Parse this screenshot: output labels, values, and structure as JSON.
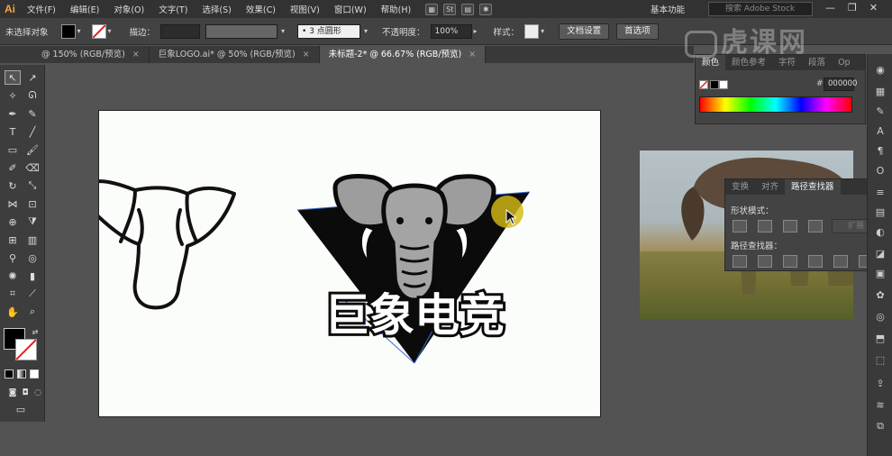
{
  "menubar": {
    "logo": "Ai",
    "items": [
      "文件(F)",
      "编辑(E)",
      "对象(O)",
      "文字(T)",
      "选择(S)",
      "效果(C)",
      "视图(V)",
      "窗口(W)",
      "帮助(H)"
    ],
    "icons": [
      "bridge-icon",
      "stock-icon",
      "arrange-icon",
      "gpu-icon"
    ],
    "workspace": "基本功能",
    "stock_search": "搜索 Adobe Stock"
  },
  "controlbar": {
    "selection": "未选择对象",
    "stroke_label": "描边：",
    "brush": "3 点圆形",
    "opacity_label": "不透明度：",
    "opacity_value": "100%",
    "style_label": "样式：",
    "doc_settings": "文档设置",
    "preferences": "首选项"
  },
  "tabs": [
    {
      "label": "@ 150% (RGB/预览)",
      "active": false
    },
    {
      "label": "巨象LOGO.ai* @ 50% (RGB/预览)",
      "active": false
    },
    {
      "label": "未标题-2* @ 66.67% (RGB/预览)",
      "active": true
    }
  ],
  "color_panel": {
    "tabs": [
      "颜色",
      "颜色参考",
      "字符",
      "段落",
      "Op"
    ],
    "hex_label": "#",
    "hex_value": "000000"
  },
  "pathfinder_panel": {
    "tabs": [
      "变换",
      "对齐",
      "路径查找器"
    ],
    "shape_modes_label": "形状模式：",
    "expand_label": "扩展",
    "pathfinders_label": "路径查找器："
  },
  "artwork": {
    "logo_text": "巨象电竞"
  },
  "watermark": "虎课网",
  "colors": {
    "accent": "#f7a43b",
    "cursor_highlight": "#d4ba14"
  }
}
